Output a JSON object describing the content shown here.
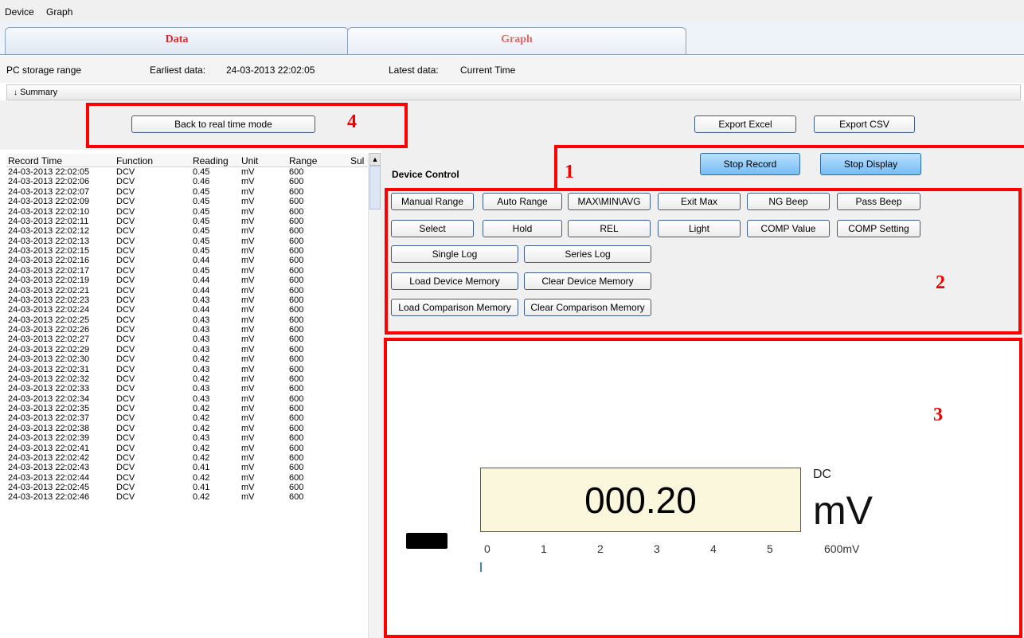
{
  "menu": [
    "Device",
    "Graph"
  ],
  "tabs": [
    {
      "label": "Data",
      "active": true
    },
    {
      "label": "Graph",
      "active": false
    }
  ],
  "info": {
    "storage_label": "PC storage range",
    "earliest_label": "Earliest data:",
    "earliest_value": "24-03-2013 22:02:05",
    "latest_label": "Latest data:",
    "latest_value": "Current Time"
  },
  "summary": {
    "label": "Summary",
    "icon": "double-chevron-down-icon"
  },
  "buttons": {
    "back": "Back to real time mode",
    "export_excel": "Export Excel",
    "export_csv": "Export CSV",
    "stop_record": "Stop Record",
    "stop_display": "Stop Display"
  },
  "device_control": {
    "title": "Device Control",
    "row1": [
      "Manual Range",
      "Auto Range",
      "MAX\\MIN\\AVG",
      "Exit Max",
      "NG Beep",
      "Pass Beep"
    ],
    "row2": [
      "Select",
      "Hold",
      "REL",
      "Light",
      "COMP Value",
      "COMP Setting"
    ],
    "row3": [
      "Single Log",
      "Series Log"
    ],
    "row4": [
      "Load Device Memory",
      "Clear Device Memory"
    ],
    "row5": [
      "Load Comparison Memory",
      "Clear Comparison Memory"
    ]
  },
  "annotations": {
    "n1": "1",
    "n2": "2",
    "n3": "3",
    "n4": "4"
  },
  "table": {
    "headers": [
      "Record Time",
      "Function",
      "Reading",
      "Unit",
      "Range",
      "Sul"
    ],
    "rows": [
      [
        "24-03-2013 22:02:05",
        "DCV",
        "0.45",
        "mV",
        "600"
      ],
      [
        "24-03-2013 22:02:06",
        "DCV",
        "0.46",
        "mV",
        "600"
      ],
      [
        "24-03-2013 22:02:07",
        "DCV",
        "0.45",
        "mV",
        "600"
      ],
      [
        "24-03-2013 22:02:09",
        "DCV",
        "0.45",
        "mV",
        "600"
      ],
      [
        "24-03-2013 22:02:10",
        "DCV",
        "0.45",
        "mV",
        "600"
      ],
      [
        "24-03-2013 22:02:11",
        "DCV",
        "0.45",
        "mV",
        "600"
      ],
      [
        "24-03-2013 22:02:12",
        "DCV",
        "0.45",
        "mV",
        "600"
      ],
      [
        "24-03-2013 22:02:13",
        "DCV",
        "0.45",
        "mV",
        "600"
      ],
      [
        "24-03-2013 22:02:15",
        "DCV",
        "0.45",
        "mV",
        "600"
      ],
      [
        "24-03-2013 22:02:16",
        "DCV",
        "0.44",
        "mV",
        "600"
      ],
      [
        "24-03-2013 22:02:17",
        "DCV",
        "0.45",
        "mV",
        "600"
      ],
      [
        "24-03-2013 22:02:19",
        "DCV",
        "0.44",
        "mV",
        "600"
      ],
      [
        "24-03-2013 22:02:21",
        "DCV",
        "0.44",
        "mV",
        "600"
      ],
      [
        "24-03-2013 22:02:23",
        "DCV",
        "0.43",
        "mV",
        "600"
      ],
      [
        "24-03-2013 22:02:24",
        "DCV",
        "0.44",
        "mV",
        "600"
      ],
      [
        "24-03-2013 22:02:25",
        "DCV",
        "0.43",
        "mV",
        "600"
      ],
      [
        "24-03-2013 22:02:26",
        "DCV",
        "0.43",
        "mV",
        "600"
      ],
      [
        "24-03-2013 22:02:27",
        "DCV",
        "0.43",
        "mV",
        "600"
      ],
      [
        "24-03-2013 22:02:29",
        "DCV",
        "0.43",
        "mV",
        "600"
      ],
      [
        "24-03-2013 22:02:30",
        "DCV",
        "0.42",
        "mV",
        "600"
      ],
      [
        "24-03-2013 22:02:31",
        "DCV",
        "0.43",
        "mV",
        "600"
      ],
      [
        "24-03-2013 22:02:32",
        "DCV",
        "0.42",
        "mV",
        "600"
      ],
      [
        "24-03-2013 22:02:33",
        "DCV",
        "0.43",
        "mV",
        "600"
      ],
      [
        "24-03-2013 22:02:34",
        "DCV",
        "0.43",
        "mV",
        "600"
      ],
      [
        "24-03-2013 22:02:35",
        "DCV",
        "0.42",
        "mV",
        "600"
      ],
      [
        "24-03-2013 22:02:37",
        "DCV",
        "0.42",
        "mV",
        "600"
      ],
      [
        "24-03-2013 22:02:38",
        "DCV",
        "0.42",
        "mV",
        "600"
      ],
      [
        "24-03-2013 22:02:39",
        "DCV",
        "0.43",
        "mV",
        "600"
      ],
      [
        "24-03-2013 22:02:41",
        "DCV",
        "0.42",
        "mV",
        "600"
      ],
      [
        "24-03-2013 22:02:42",
        "DCV",
        "0.42",
        "mV",
        "600"
      ],
      [
        "24-03-2013 22:02:43",
        "DCV",
        "0.41",
        "mV",
        "600"
      ],
      [
        "24-03-2013 22:02:44",
        "DCV",
        "0.42",
        "mV",
        "600"
      ],
      [
        "24-03-2013 22:02:45",
        "DCV",
        "0.41",
        "mV",
        "600"
      ],
      [
        "24-03-2013 22:02:46",
        "DCV",
        "0.42",
        "mV",
        "600"
      ]
    ]
  },
  "meter": {
    "reading": "000.20",
    "mode": "DC",
    "unit": "mV",
    "scale_ticks": [
      "0",
      "1",
      "2",
      "3",
      "4",
      "5"
    ],
    "range_label": "600mV",
    "bar_fraction": 0.0
  }
}
